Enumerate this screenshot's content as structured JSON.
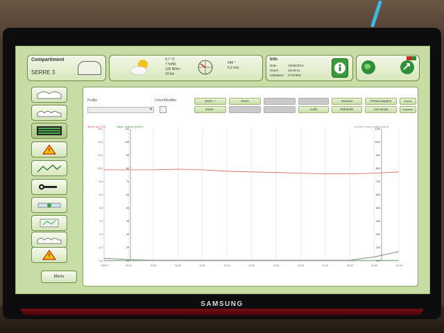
{
  "header": {
    "compartment_title": "Compartiment",
    "compartment_name": "SERRE 3",
    "weather": {
      "temperature": "9,7 °C",
      "humidity": "7 %HR",
      "radiation": "125 W/m²",
      "lux": "23 klx",
      "wind_direction": "245 °",
      "wind_speed": "6,2 m/s"
    },
    "info": {
      "title": "Info",
      "rows": [
        {
          "label": "Date",
          "value": "15/05/2013"
        },
        {
          "label": "Heure",
          "value": "18:25:41"
        },
        {
          "label": "Utilisateur",
          "value": "SYSTEM"
        }
      ]
    }
  },
  "sidebar": {
    "menu_label": "Menu"
  },
  "toolbar": {
    "profile_label": "Profiły",
    "create_modify_label": "Créer/Modifier",
    "row1": [
      "Zoom +",
      "Zoom",
      "",
      "",
      "Scanner",
      "Presse papiers",
      "Export archives"
    ],
    "row2": [
      "Zoom -",
      "",
      "",
      "Actifs",
      "Rafraîchir",
      "Axe temps",
      "Imprimer"
    ]
  },
  "chart_data": {
    "type": "line",
    "left_axis_label": "Temp. ext. [°C]",
    "left2_axis_label": "Rayo. externe [W/m²]",
    "right_axis_label": "Lumière enreg. indice [klx/h]",
    "left_ticks": [
      "16,0",
      "14,0",
      "12,0",
      "10,0",
      "8,0",
      "6,0",
      "4,0",
      "2,0",
      "0,0",
      "-2,0",
      "-4,0"
    ],
    "left2_ticks": [
      "110",
      "100",
      "90",
      "80",
      "70",
      "60",
      "50",
      "40",
      "30",
      "20",
      "10"
    ],
    "right_ticks": [
      "1100",
      "1000",
      "900",
      "800",
      "700",
      "600",
      "500",
      "400",
      "300",
      "200",
      "100"
    ],
    "x_ticks": [
      "18:00",
      "18:15",
      "18:30",
      "18:45",
      "19:00",
      "19:15",
      "19:30",
      "19:45",
      "20:00",
      "20:15",
      "20:30",
      "20:45",
      "21:00"
    ],
    "ylim": [
      -4,
      16
    ],
    "series": [
      {
        "color": "#e05555",
        "values": [
          9.8,
          9.8,
          9.8,
          9.9,
          9.8,
          9.6,
          9.5,
          9.4,
          9.3,
          9.2,
          9.2,
          9.3,
          9.5
        ]
      },
      {
        "color": "#6aa86a",
        "values": [
          -3.9,
          -3.9,
          -3.9,
          -3.9,
          -3.9,
          -3.9,
          -3.9,
          -3.9,
          -3.9,
          -3.9,
          -3.9,
          -3.9,
          -3.9
        ]
      },
      {
        "color": "#777777",
        "values": [
          -3.6,
          -3.8,
          -3.9,
          -3.9,
          -3.9,
          -3.9,
          -3.9,
          -3.9,
          -3.9,
          -3.9,
          -3.9,
          -3.4,
          -2.6
        ]
      }
    ]
  }
}
